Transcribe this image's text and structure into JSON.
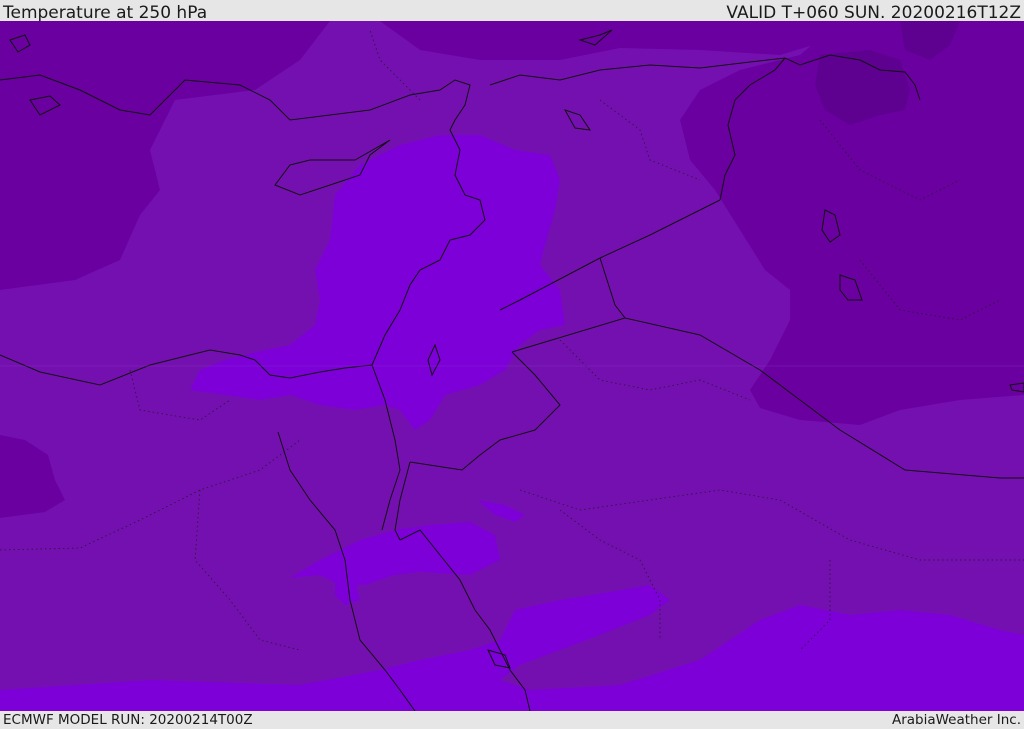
{
  "header": {
    "title": "Temperature at 250 hPa",
    "valid_time": "VALID T+060 SUN. 20200216T12Z"
  },
  "footer": {
    "model_run": "ECMWF MODEL RUN: 20200214T00Z",
    "credit": "ArabiaWeather Inc."
  },
  "map": {
    "variable": "temperature",
    "pressure_level_hpa": 250,
    "palette": {
      "coldest": "#5e0090",
      "cold": "#6a00a0",
      "mid": "#7510b0",
      "warm": "#7d00d8"
    },
    "border_color": "#111111"
  }
}
